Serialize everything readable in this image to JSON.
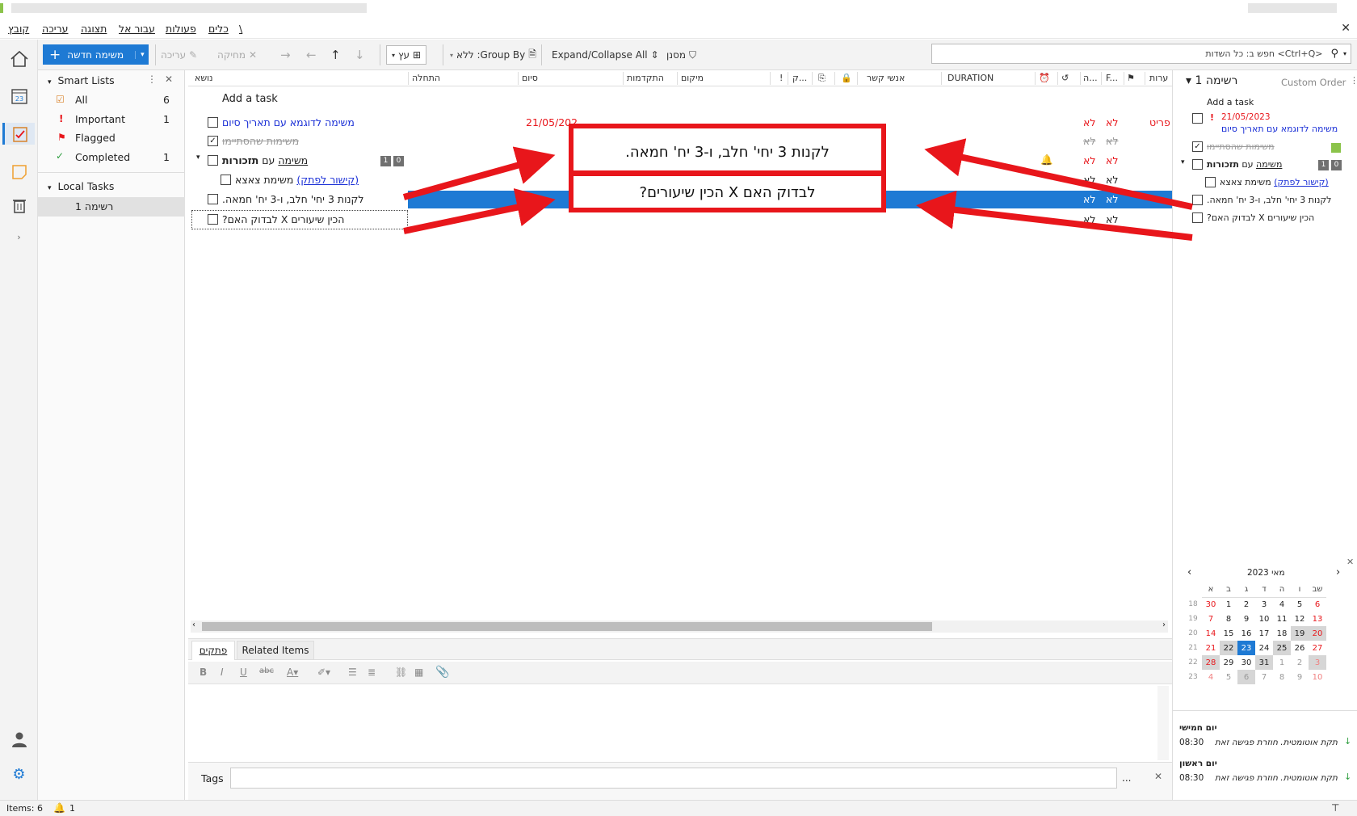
{
  "menu": [
    "קובץ",
    "עריכה",
    "תצוגה",
    "עבור אל",
    "פעולות",
    "כלים",
    "\\"
  ],
  "toolbar": {
    "new_task": "משימה חדשה",
    "edit": "עריכה",
    "delete": "מחיקה",
    "tree": "עץ",
    "group_by": "Group By: ללא",
    "expand_collapse": "Expand/Collapse All",
    "filter": "מסנן",
    "search_placeholder": "חפש ב: כל השדות  <Ctrl+Q>"
  },
  "nav": {
    "smart_lists": "Smart Lists",
    "all": "All",
    "all_count": "6",
    "important": "Important",
    "important_count": "1",
    "flagged": "Flagged",
    "completed": "Completed",
    "completed_count": "1",
    "local_tasks": "Local Tasks",
    "list1": "רשימה 1"
  },
  "grid": {
    "headers": {
      "subject": "נושא",
      "start": "התחלה",
      "end": "סיום",
      "progress": "התקדמות",
      "location": "מיקום",
      "excl": "!",
      "k": "ק...",
      "contacts": "אנשי קשר",
      "duration": "DURATION",
      "h": "ה...",
      "f": "F...",
      "notes": "ערות"
    },
    "add_task": "Add a task",
    "rows": [
      {
        "subject": "משימה לדוגמא עם תאריך סיום",
        "end": "21/05/202",
        "f1": "לא",
        "f2": "לא",
        "notes": "פריט"
      },
      {
        "subject": "משימות שהסתיימו",
        "f1": "לא",
        "f2": "לא"
      },
      {
        "subject_bold": "תזכורות",
        "subject_mid": "עם",
        "subject_link": "משימה",
        "f1": "לא",
        "f2": "לא",
        "badge1": "1",
        "badge2": "0"
      },
      {
        "subject_pre": "משימת צאצא",
        "subject_link": "קישור לפתק",
        "f1": "לא",
        "f2": "לא"
      },
      {
        "subject": "לקנות 3 יחי' חלב, ו-3 יח' חמאה.",
        "f1": "לא",
        "f2": "לא"
      },
      {
        "subject": "הכין שיעורים X לבדוק האם?",
        "f1": "לא",
        "f2": "לא"
      }
    ]
  },
  "callouts": {
    "box1": "לקנות 3 יחי' חלב, ו-3 יח' חמאה.",
    "box2": "לבדוק האם X הכין שיעורים?"
  },
  "notes": {
    "tab_notes": "פתקים",
    "tab_related": "Related Items",
    "tags_label": "Tags",
    "tags_btn": "..."
  },
  "right": {
    "list_title": "רשימה 1",
    "order": "Custom Order",
    "add_task": "Add a task",
    "item1_date": "21/05/2023",
    "item1": "משימה לדוגמא עם תאריך סיום",
    "item2": "משימות שהסתיימו",
    "item3_bold": "תזכורות",
    "item3_mid": "עם",
    "item3_link": "משימה",
    "item4_pre": "משימת צאצא",
    "item4_link": "קישור לפתק",
    "item5": "לקנות 3 יחי' חלב, ו-3 יח' חמאה.",
    "item6": "הכין שיעורים X לבדוק האם?",
    "badge1": "1",
    "badge2": "0"
  },
  "calendar": {
    "title": "מאי  2023",
    "days": [
      "שב",
      "ו",
      "ה",
      "ד",
      "ג",
      "ב",
      "א"
    ],
    "weeks": [
      {
        "wk": "18",
        "d": [
          "6",
          "5",
          "4",
          "3",
          "2",
          "1",
          "30"
        ]
      },
      {
        "wk": "19",
        "d": [
          "13",
          "12",
          "11",
          "10",
          "9",
          "8",
          "7"
        ]
      },
      {
        "wk": "20",
        "d": [
          "20",
          "19",
          "18",
          "17",
          "16",
          "15",
          "14"
        ]
      },
      {
        "wk": "21",
        "d": [
          "27",
          "26",
          "25",
          "24",
          "23",
          "22",
          "21"
        ]
      },
      {
        "wk": "22",
        "d": [
          "3",
          "2",
          "1",
          "31",
          "30",
          "29",
          "28"
        ]
      },
      {
        "wk": "23",
        "d": [
          "10",
          "9",
          "8",
          "7",
          "6",
          "5",
          "4"
        ]
      }
    ]
  },
  "agenda": [
    {
      "day": "יום חמישי",
      "time": "08:30",
      "text": "תקת אוטומטית. חוזרת פגישה זאת"
    },
    {
      "day": "יום ראשון",
      "time": "08:30",
      "text": "תקת אוטומטית. חוזרת פגישה זאת"
    }
  ],
  "status": {
    "items": "Items: 6",
    "bell": "1"
  },
  "colors": {
    "accent": "#1e7ad4",
    "red": "#e8161b",
    "link": "#1a2fd6",
    "date_red": "#e8161b",
    "selected_row": "#1e7ad4"
  }
}
